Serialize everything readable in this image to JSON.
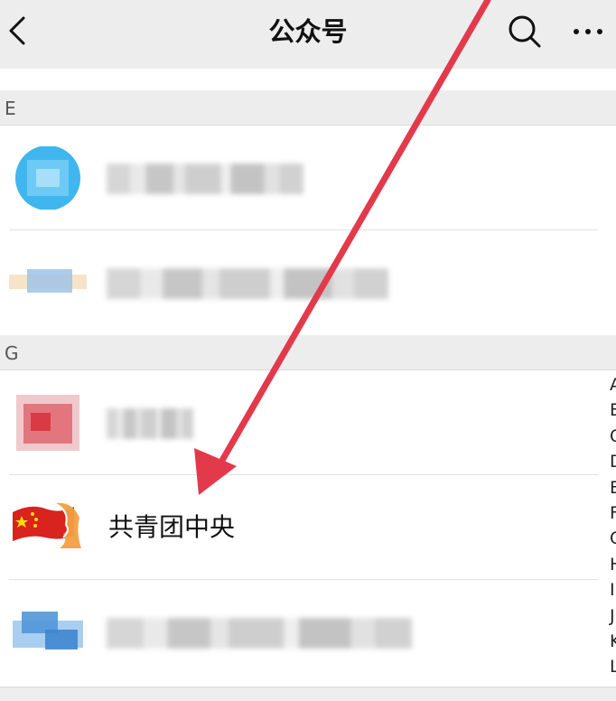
{
  "navbar": {
    "title": "公众号",
    "back_icon": "chevron-left-icon",
    "search_icon": "search-icon",
    "more_icon": "more-dots-icon"
  },
  "sections": [
    {
      "letter": "E"
    },
    {
      "letter": "G"
    }
  ],
  "rows": {
    "highlighted_account": "共青团中央"
  },
  "index_bar": [
    "A",
    "B",
    "C",
    "D",
    "E",
    "F",
    "G",
    "H",
    "I",
    "J",
    "K",
    "L"
  ],
  "colors": {
    "background": "#ededed",
    "list_bg": "#ffffff",
    "annotation_arrow": "#e23a4b"
  }
}
